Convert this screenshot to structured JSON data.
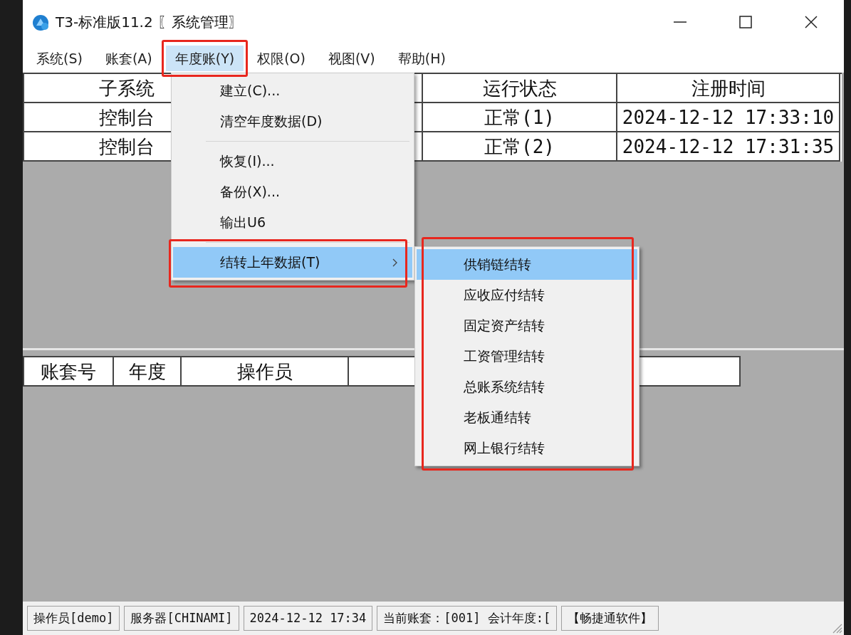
{
  "window": {
    "title": "T3-标准版11.2 〖系统管理〗"
  },
  "menu_bar": [
    {
      "label": "系统(S)",
      "selected": false
    },
    {
      "label": "账套(A)",
      "selected": false
    },
    {
      "label": "年度账(Y)",
      "selected": true
    },
    {
      "label": "权限(O)",
      "selected": false
    },
    {
      "label": "视图(V)",
      "selected": false
    },
    {
      "label": "帮助(H)",
      "selected": false
    }
  ],
  "subsystems_table": {
    "columns": [
      "子系统",
      "运行状态",
      "注册时间"
    ],
    "rows": [
      [
        "控制台",
        "正常(1)",
        "2024-12-12 17:33:10"
      ],
      [
        "控制台",
        "正常(2)",
        "2024-12-12 17:31:35"
      ]
    ]
  },
  "sessions_table": {
    "columns": [
      "账套号",
      "年度",
      "操作员"
    ]
  },
  "dropdown": {
    "items": [
      {
        "kind": "item",
        "label": "建立(C)...",
        "selected": false
      },
      {
        "kind": "item",
        "label": "清空年度数据(D)",
        "selected": false
      },
      {
        "kind": "separator"
      },
      {
        "kind": "item",
        "label": "恢复(I)...",
        "selected": false
      },
      {
        "kind": "item",
        "label": "备份(X)...",
        "selected": false
      },
      {
        "kind": "item",
        "label": "输出U6",
        "selected": false
      },
      {
        "kind": "separator"
      },
      {
        "kind": "submenu",
        "label": "结转上年数据(T)",
        "selected": true
      }
    ]
  },
  "submenu": {
    "items": [
      {
        "label": "供销链结转",
        "selected": true
      },
      {
        "label": "应收应付结转",
        "selected": false
      },
      {
        "label": "固定资产结转",
        "selected": false
      },
      {
        "label": "工资管理结转",
        "selected": false
      },
      {
        "label": "总账系统结转",
        "selected": false
      },
      {
        "label": "老板通结转",
        "selected": false
      },
      {
        "label": "网上银行结转",
        "selected": false
      }
    ]
  },
  "status_bar": [
    "操作员[demo]",
    "服务器[CHINAMI]",
    "2024-12-12 17:34",
    "当前账套：[001] 会计年度:[",
    "【畅捷通软件】"
  ]
}
